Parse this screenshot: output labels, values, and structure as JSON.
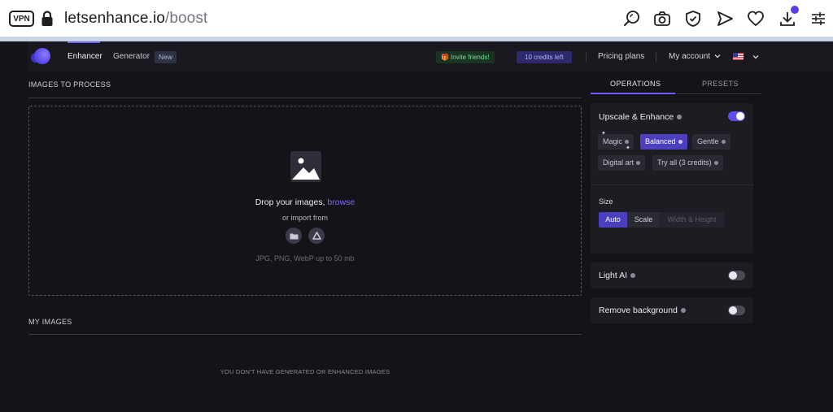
{
  "browser": {
    "vpn_label": "VPN",
    "url_domain": "letsenhance.io",
    "url_path": "/boost",
    "icons": [
      "search-icon",
      "camera-icon",
      "shield-check-icon",
      "send-icon",
      "heart-icon",
      "download-icon",
      "settings-sliders-icon"
    ],
    "accent_dot_color": "#5a3be6"
  },
  "nav": {
    "enhancer_label": "Enhancer",
    "generator_label": "Generator",
    "new_badge": "New",
    "invite_label": "Invite friends!",
    "credits_label": "10 credits left",
    "pricing_label": "Pricing plans",
    "account_label": "My account",
    "flag_icon": "us-flag-icon",
    "accent_color": "#6a5cff"
  },
  "images": {
    "title": "IMAGES TO PROCESS",
    "drop_prefix": "Drop your images,",
    "browse_label": "browse",
    "import_label": "or import from",
    "import_icons": [
      "folder-icon",
      "google-drive-icon"
    ],
    "formats": "JPG, PNG, WebP up to 50 mb"
  },
  "my_images": {
    "title": "MY IMAGES",
    "empty": "YOU DON'T HAVE GENERATED OR ENHANCED IMAGES"
  },
  "panel": {
    "tabs": [
      {
        "label": "OPERATIONS",
        "active": true
      },
      {
        "label": "PRESETS",
        "active": false
      }
    ],
    "upscale": {
      "title": "Upscale & Enhance",
      "enabled": true,
      "modes": [
        {
          "label": "Magic",
          "active": false
        },
        {
          "label": "Balanced",
          "active": true
        },
        {
          "label": "Gentle",
          "active": false
        },
        {
          "label": "Digital art",
          "active": false
        },
        {
          "label": "Try all (3 credits)",
          "active": false
        }
      ]
    },
    "size": {
      "label": "Size",
      "options": [
        {
          "label": "Auto",
          "active": true
        },
        {
          "label": "Scale",
          "active": false
        },
        {
          "label": "Width & Height",
          "active": false,
          "disabled": true
        }
      ]
    },
    "light_ai": {
      "title": "Light AI",
      "enabled": false
    },
    "remove_bg": {
      "title": "Remove background",
      "enabled": false
    }
  }
}
